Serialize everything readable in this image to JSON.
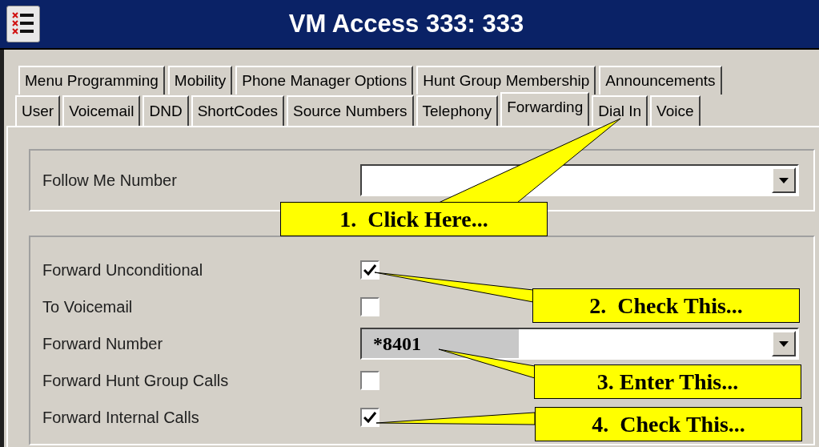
{
  "window": {
    "title": "VM Access 333: 333"
  },
  "tab_rows": [
    [
      {
        "label": "Menu Programming",
        "selected": false
      },
      {
        "label": "Mobility",
        "selected": false
      },
      {
        "label": "Phone Manager Options",
        "selected": false
      },
      {
        "label": "Hunt Group Membership",
        "selected": false
      },
      {
        "label": "Announcements",
        "selected": false
      }
    ],
    [
      {
        "label": "User",
        "selected": false
      },
      {
        "label": "Voicemail",
        "selected": false
      },
      {
        "label": "DND",
        "selected": false
      },
      {
        "label": "ShortCodes",
        "selected": false
      },
      {
        "label": "Source Numbers",
        "selected": false
      },
      {
        "label": "Telephony",
        "selected": false
      },
      {
        "label": "Forwarding",
        "selected": true
      },
      {
        "label": "Dial In",
        "selected": false
      },
      {
        "label": "Voice",
        "selected": false
      }
    ]
  ],
  "groups": [
    [
      {
        "kind": "dropdown",
        "label": "Follow Me Number"
      }
    ],
    [
      {
        "kind": "checkbox",
        "label": "Forward Unconditional",
        "checked": true
      },
      {
        "kind": "checkbox",
        "label": "To Voicemail",
        "checked": false
      },
      {
        "kind": "dropdown",
        "label": "Forward Number",
        "value": "*8401"
      },
      {
        "kind": "checkbox",
        "label": "Forward Hunt Group Calls",
        "checked": false
      },
      {
        "kind": "checkbox",
        "label": "Forward Internal Calls",
        "checked": true
      }
    ]
  ],
  "callouts": [
    {
      "text": "1.  Click Here..."
    },
    {
      "text": "2.  Check This..."
    },
    {
      "text": "3. Enter This..."
    },
    {
      "text": "4.  Check This..."
    }
  ]
}
